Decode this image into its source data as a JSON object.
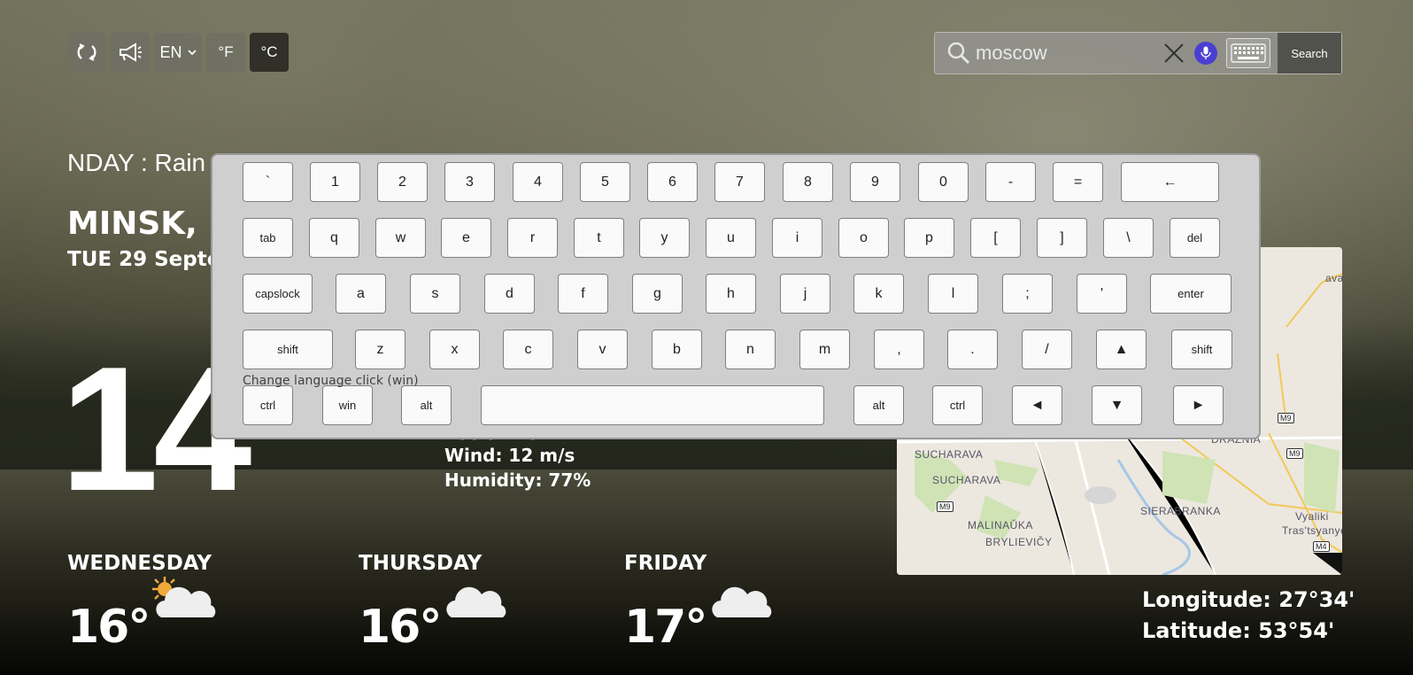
{
  "header": {
    "refresh_icon": "refresh-icon",
    "speak_icon": "megaphone-icon",
    "language": "EN",
    "unit_f": "°F",
    "unit_c": "°C",
    "active_unit": "°C"
  },
  "search": {
    "value": "moscow",
    "button": "Search"
  },
  "weather": {
    "marquee": "NDAY : Rain",
    "city": "MINSK, E",
    "date": "TUE 29 Septe",
    "temperature": "14",
    "feels_like": "Feels like: 14",
    "wind": "Wind: 12 m/s",
    "humidity": "Humidity: 77%"
  },
  "forecast": [
    {
      "day": "WEDNESDAY",
      "temp": "16°",
      "icon": "partly-cloudy-icon"
    },
    {
      "day": "THURSDAY",
      "temp": "16°",
      "icon": "cloud-icon"
    },
    {
      "day": "FRIDAY",
      "temp": "17°",
      "icon": "cloud-icon"
    }
  ],
  "map": {
    "labels": [
      "SUCHARAVA",
      "SUCHARAVA",
      "MALINAŬKA",
      "BRYLIEVIČY",
      "SIERABRANKA",
      "DRAZNIA",
      "Vyaliki",
      "Tras'tsyanye",
      "ava"
    ],
    "shields": [
      "M9",
      "M9",
      "M9",
      "M4"
    ]
  },
  "coordinates": {
    "longitude": "Longitude: 27°34'",
    "latitude": "Latitude: 53°54'"
  },
  "keyboard": {
    "hint": "Change language click (win)",
    "rows": [
      [
        "`",
        "1",
        "2",
        "3",
        "4",
        "5",
        "6",
        "7",
        "8",
        "9",
        "0",
        "-",
        "=",
        "←"
      ],
      [
        "tab",
        "q",
        "w",
        "e",
        "r",
        "t",
        "y",
        "u",
        "i",
        "o",
        "p",
        "[",
        "]",
        "\\",
        "del"
      ],
      [
        "capslock",
        "a",
        "s",
        "d",
        "f",
        "g",
        "h",
        "j",
        "k",
        "l",
        ";",
        "'",
        "enter"
      ],
      [
        "shift",
        "z",
        "x",
        "c",
        "v",
        "b",
        "n",
        "m",
        ",",
        ".",
        "/",
        "▲",
        "shift"
      ],
      [
        "ctrl",
        "win",
        "alt",
        " ",
        "alt",
        "ctrl",
        "◄",
        "▼",
        "►"
      ]
    ]
  }
}
